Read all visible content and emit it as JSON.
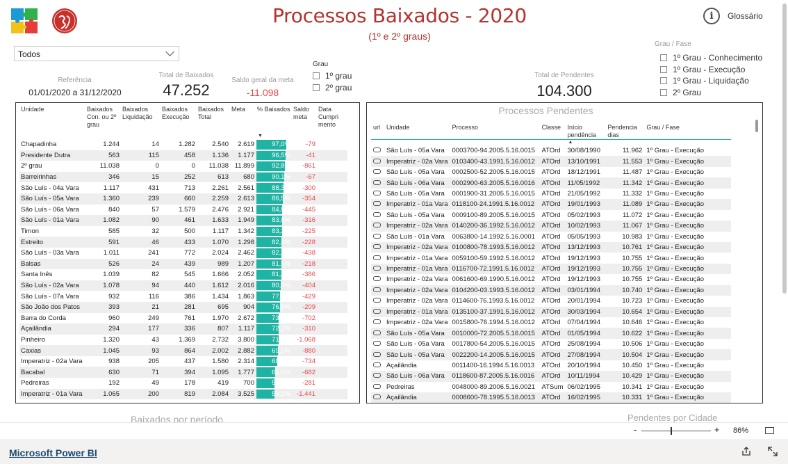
{
  "header": {
    "title": "Processos Baixados - 2020",
    "subtitle": "(1º e 2º graus)",
    "glossary_label": "Glossário"
  },
  "filter": {
    "selected": "Todos"
  },
  "kpis": {
    "referencia_label": "Referência",
    "referencia_value": "01/01/2020 a 31/12/2020",
    "total_baixados_label": "Total de Baixados",
    "total_baixados_value": "47.252",
    "saldo_label": "Saldo geral da meta",
    "saldo_value": "-11.098",
    "total_pendentes_label": "Total de Pendentes",
    "total_pendentes_value": "104.300"
  },
  "grau_filter": {
    "title": "Grau",
    "options": [
      "1º grau",
      "2º grau"
    ]
  },
  "grau_fase_filter": {
    "title": "Grau / Fase",
    "options": [
      "1º Grau - Conhecimento",
      "1º Grau - Execução",
      "1º Grau - Liquidação",
      "2º Grau"
    ]
  },
  "baixados_table": {
    "headers": [
      "Unidade",
      "Baixados Con. ou 2º grau",
      "Baixados Liquidação",
      "Baixados Execução",
      "Baixados Total",
      "Meta",
      "% Baixados",
      "Saldo meta",
      "Data Cumpri mento"
    ],
    "rows": [
      {
        "unidade": "Chapadinha",
        "con": "1.244",
        "liq": "14",
        "exe": "1.282",
        "total": "2.540",
        "meta": "2.619",
        "pct": "97,0%",
        "pct_value": 97.0,
        "saldo": "-79"
      },
      {
        "unidade": "Presidente Dutra",
        "con": "563",
        "liq": "115",
        "exe": "458",
        "total": "1.136",
        "meta": "1.177",
        "pct": "96,5%",
        "pct_value": 96.5,
        "saldo": "-41"
      },
      {
        "unidade": "2º grau",
        "con": "11.038",
        "liq": "0",
        "exe": "0",
        "total": "11.038",
        "meta": "11.899",
        "pct": "92,8%",
        "pct_value": 92.8,
        "saldo": "-861"
      },
      {
        "unidade": "Barreirinhas",
        "con": "346",
        "liq": "15",
        "exe": "252",
        "total": "613",
        "meta": "680",
        "pct": "90,1%",
        "pct_value": 90.1,
        "saldo": "-67"
      },
      {
        "unidade": "São Luís - 04a Vara",
        "con": "1.117",
        "liq": "431",
        "exe": "713",
        "total": "2.261",
        "meta": "2.561",
        "pct": "88,3%",
        "pct_value": 88.3,
        "saldo": "-300"
      },
      {
        "unidade": "São Luís - 05a Vara",
        "con": "1.360",
        "liq": "239",
        "exe": "660",
        "total": "2.259",
        "meta": "2.613",
        "pct": "86,5%",
        "pct_value": 86.5,
        "saldo": "-354"
      },
      {
        "unidade": "São Luís - 06a Vara",
        "con": "840",
        "liq": "57",
        "exe": "1.579",
        "total": "2.476",
        "meta": "2.921",
        "pct": "84,8%",
        "pct_value": 84.8,
        "saldo": "-445"
      },
      {
        "unidade": "São Luís - 01a Vara",
        "con": "1.082",
        "liq": "90",
        "exe": "461",
        "total": "1.633",
        "meta": "1.949",
        "pct": "83,8%",
        "pct_value": 83.8,
        "saldo": "-316"
      },
      {
        "unidade": "Timon",
        "con": "585",
        "liq": "32",
        "exe": "500",
        "total": "1.117",
        "meta": "1.342",
        "pct": "83,2%",
        "pct_value": 83.2,
        "saldo": "-225"
      },
      {
        "unidade": "Estreito",
        "con": "591",
        "liq": "46",
        "exe": "433",
        "total": "1.070",
        "meta": "1.298",
        "pct": "82,4%",
        "pct_value": 82.4,
        "saldo": "-228"
      },
      {
        "unidade": "São Luís - 03a Vara",
        "con": "1.011",
        "liq": "241",
        "exe": "772",
        "total": "2.024",
        "meta": "2.462",
        "pct": "82,2%",
        "pct_value": 82.2,
        "saldo": "-438"
      },
      {
        "unidade": "Balsas",
        "con": "526",
        "liq": "24",
        "exe": "439",
        "total": "989",
        "meta": "1.207",
        "pct": "81,9%",
        "pct_value": 81.9,
        "saldo": "-218"
      },
      {
        "unidade": "Santa Inês",
        "con": "1.039",
        "liq": "82",
        "exe": "545",
        "total": "1.666",
        "meta": "2.052",
        "pct": "81,2%",
        "pct_value": 81.2,
        "saldo": "-386"
      },
      {
        "unidade": "São Luís - 02a Vara",
        "con": "1.078",
        "liq": "94",
        "exe": "440",
        "total": "1.612",
        "meta": "2.016",
        "pct": "80,0%",
        "pct_value": 80.0,
        "saldo": "-404"
      },
      {
        "unidade": "São Luís - 07a Vara",
        "con": "932",
        "liq": "116",
        "exe": "386",
        "total": "1.434",
        "meta": "1.863",
        "pct": "77,0%",
        "pct_value": 77.0,
        "saldo": "-429"
      },
      {
        "unidade": "São João dos Patos",
        "con": "393",
        "liq": "21",
        "exe": "281",
        "total": "695",
        "meta": "904",
        "pct": "76,9%",
        "pct_value": 76.9,
        "saldo": "-209"
      },
      {
        "unidade": "Barra do Corda",
        "con": "960",
        "liq": "249",
        "exe": "761",
        "total": "1.970",
        "meta": "2.672",
        "pct": "73,7%",
        "pct_value": 73.7,
        "saldo": "-702"
      },
      {
        "unidade": "Açailândia",
        "con": "294",
        "liq": "177",
        "exe": "336",
        "total": "807",
        "meta": "1.117",
        "pct": "72,2%",
        "pct_value": 72.2,
        "saldo": "-310"
      },
      {
        "unidade": "Pinheiro",
        "con": "1.320",
        "liq": "43",
        "exe": "1.369",
        "total": "2.732",
        "meta": "3.800",
        "pct": "71,9%",
        "pct_value": 71.9,
        "saldo": "-1.068"
      },
      {
        "unidade": "Caxias",
        "con": "1.045",
        "liq": "93",
        "exe": "864",
        "total": "2.002",
        "meta": "2.882",
        "pct": "69,5%",
        "pct_value": 69.5,
        "saldo": "-880"
      },
      {
        "unidade": "Imperatriz - 02a Vara",
        "con": "938",
        "liq": "205",
        "exe": "437",
        "total": "1.580",
        "meta": "2.314",
        "pct": "68,3%",
        "pct_value": 68.3,
        "saldo": "-734"
      },
      {
        "unidade": "Bacabal",
        "con": "630",
        "liq": "71",
        "exe": "394",
        "total": "1.095",
        "meta": "1.777",
        "pct": "61,6%",
        "pct_value": 61.6,
        "saldo": "-682"
      },
      {
        "unidade": "Pedreiras",
        "con": "192",
        "liq": "49",
        "exe": "178",
        "total": "419",
        "meta": "700",
        "pct": "59,9%",
        "pct_value": 59.9,
        "saldo": "-281"
      },
      {
        "unidade": "Imperatriz - 01a Vara",
        "con": "1.065",
        "liq": "200",
        "exe": "819",
        "total": "2.084",
        "meta": "3.525",
        "pct": "59,1%",
        "pct_value": 59.1,
        "saldo": "-1.441"
      }
    ]
  },
  "pendentes_table": {
    "title": "Processos Pendentes",
    "headers": [
      "url",
      "Unidade",
      "Processo",
      "Classe",
      "Início pendência",
      "Pendencia dias",
      "Grau / Fase"
    ],
    "rows": [
      {
        "unidade": "São Luís - 05a Vara",
        "processo": "0003700-94.2005.5.16.0015",
        "classe": "ATOrd",
        "inicio": "30/08/1990",
        "dias": "11.962",
        "fase": "1º Grau - Execução"
      },
      {
        "unidade": "Imperatriz - 02a Vara",
        "processo": "0103400-43.1991.5.16.0012",
        "classe": "ATOrd",
        "inicio": "13/10/1991",
        "dias": "11.553",
        "fase": "1º Grau - Execução"
      },
      {
        "unidade": "São Luís - 05a Vara",
        "processo": "0002500-52.2005.5.16.0015",
        "classe": "ATOrd",
        "inicio": "18/12/1991",
        "dias": "11.487",
        "fase": "1º Grau - Execução"
      },
      {
        "unidade": "São Luís - 06a Vara",
        "processo": "0002900-63.2005.5.16.0016",
        "classe": "ATOrd",
        "inicio": "11/05/1992",
        "dias": "11.342",
        "fase": "1º Grau - Execução"
      },
      {
        "unidade": "São Luís - 05a Vara",
        "processo": "0001900-31.2005.5.16.0015",
        "classe": "ATOrd",
        "inicio": "21/05/1992",
        "dias": "11.332",
        "fase": "1º Grau - Execução"
      },
      {
        "unidade": "Imperatriz - 01a Vara",
        "processo": "0118100-24.1991.5.16.0012",
        "classe": "ATOrd",
        "inicio": "19/01/1993",
        "dias": "11.089",
        "fase": "1º Grau - Execução"
      },
      {
        "unidade": "São Luís - 05a Vara",
        "processo": "0009100-89.2005.5.16.0015",
        "classe": "ATOrd",
        "inicio": "05/02/1993",
        "dias": "11.072",
        "fase": "1º Grau - Execução"
      },
      {
        "unidade": "Imperatriz - 02a Vara",
        "processo": "0140200-36.1992.5.16.0012",
        "classe": "ATOrd",
        "inicio": "10/02/1993",
        "dias": "11.067",
        "fase": "1º Grau - Execução"
      },
      {
        "unidade": "São Luís - 01a Vara",
        "processo": "0063800-14.1992.5.16.0001",
        "classe": "ATOrd",
        "inicio": "05/05/1993",
        "dias": "10.983",
        "fase": "1º Grau - Execução"
      },
      {
        "unidade": "Imperatriz - 02a Vara",
        "processo": "0100800-78.1993.5.16.0012",
        "classe": "ATOrd",
        "inicio": "13/12/1993",
        "dias": "10.761",
        "fase": "1º Grau - Execução"
      },
      {
        "unidade": "Imperatriz - 01a Vara",
        "processo": "0059100-59.1992.5.16.0012",
        "classe": "ATOrd",
        "inicio": "19/12/1993",
        "dias": "10.755",
        "fase": "1º Grau - Execução"
      },
      {
        "unidade": "Imperatriz - 01a Vara",
        "processo": "0116700-72.1991.5.16.0012",
        "classe": "ATOrd",
        "inicio": "19/12/1993",
        "dias": "10.755",
        "fase": "1º Grau - Execução"
      },
      {
        "unidade": "Imperatriz - 02a Vara",
        "processo": "0061600-69.1990.5.16.0012",
        "classe": "ATOrd",
        "inicio": "19/12/1993",
        "dias": "10.755",
        "fase": "1º Grau - Execução"
      },
      {
        "unidade": "Imperatriz - 02a Vara",
        "processo": "0104200-03.1993.5.16.0012",
        "classe": "ATOrd",
        "inicio": "03/01/1994",
        "dias": "10.740",
        "fase": "1º Grau - Execução"
      },
      {
        "unidade": "Imperatriz - 02a Vara",
        "processo": "0114600-76.1993.5.16.0012",
        "classe": "ATOrd",
        "inicio": "20/01/1994",
        "dias": "10.723",
        "fase": "1º Grau - Execução"
      },
      {
        "unidade": "Imperatriz - 01a Vara",
        "processo": "0135100-37.1991.5.16.0012",
        "classe": "ATOrd",
        "inicio": "30/03/1994",
        "dias": "10.654",
        "fase": "1º Grau - Execução"
      },
      {
        "unidade": "Imperatriz - 02a Vara",
        "processo": "0015800-76.1994.5.16.0012",
        "classe": "ATOrd",
        "inicio": "07/04/1994",
        "dias": "10.646",
        "fase": "1º Grau - Execução"
      },
      {
        "unidade": "São Luís - 05a Vara",
        "processo": "0010000-72.2005.5.16.0015",
        "classe": "ATOrd",
        "inicio": "01/05/1994",
        "dias": "10.622",
        "fase": "1º Grau - Execução"
      },
      {
        "unidade": "São Luís - 05a Vara",
        "processo": "0017800-54.2005.5.16.0015",
        "classe": "ATOrd",
        "inicio": "25/08/1994",
        "dias": "10.506",
        "fase": "1º Grau - Execução"
      },
      {
        "unidade": "São Luís - 05a Vara",
        "processo": "0022200-14.2005.5.16.0015",
        "classe": "ATOrd",
        "inicio": "27/08/1994",
        "dias": "10.504",
        "fase": "1º Grau - Execução"
      },
      {
        "unidade": "Açailândia",
        "processo": "0011400-16.1994.5.16.0013",
        "classe": "ATOrd",
        "inicio": "20/10/1994",
        "dias": "10.450",
        "fase": "1º Grau - Execução"
      },
      {
        "unidade": "São Luís - 06a Vara",
        "processo": "0118600-87.2005.5.16.0016",
        "classe": "ATOrd",
        "inicio": "10/11/1994",
        "dias": "10.429",
        "fase": "1º Grau - Execução"
      },
      {
        "unidade": "Pedreiras",
        "processo": "0048000-89.2006.5.16.0021",
        "classe": "ATSum",
        "inicio": "06/02/1995",
        "dias": "10.341",
        "fase": "1º Grau - Execução"
      },
      {
        "unidade": "Açailândia",
        "processo": "0008600-78.1995.5.16.0013",
        "classe": "ATOrd",
        "inicio": "16/02/1995",
        "dias": "10.331",
        "fase": "1º Grau - Execução"
      }
    ]
  },
  "sections": {
    "baixados_periodo": "Baixados por período",
    "pendentes_cidade": "Pendentes por Cidade"
  },
  "zoom": {
    "minus": "-",
    "plus": "+",
    "value": "86%",
    "level": 0.5
  },
  "footer": {
    "brand": "Microsoft Power BI"
  },
  "colors": {
    "title": "#b5322e",
    "bar": "#1fb3a3",
    "negative": "#e8484c"
  }
}
